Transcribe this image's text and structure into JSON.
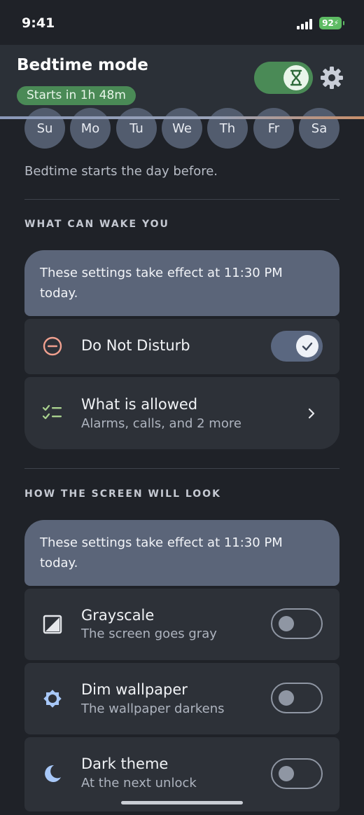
{
  "status": {
    "time": "9:41",
    "battery": "92"
  },
  "header": {
    "title": "Bedtime mode",
    "badge": "Starts in 1h 48m"
  },
  "days": [
    "Su",
    "Mo",
    "Tu",
    "We",
    "Th",
    "Fr",
    "Sa"
  ],
  "days_note": "Bedtime starts the day before.",
  "wake": {
    "section_title": "WHAT CAN WAKE YOU",
    "banner": "These settings take effect at 11:30 PM today.",
    "dnd_label": "Do Not Disturb",
    "allowed_title": "What is allowed",
    "allowed_sub": "Alarms, calls, and 2 more"
  },
  "screen": {
    "section_title": "HOW THE SCREEN WILL LOOK",
    "banner": "These settings take effect at 11:30 PM today.",
    "grayscale_title": "Grayscale",
    "grayscale_sub": "The screen goes gray",
    "dim_title": "Dim wallpaper",
    "dim_sub": "The wallpaper darkens",
    "dark_title": "Dark theme",
    "dark_sub": "At the next unlock"
  },
  "colors": {
    "accent_green": "#4a8a56",
    "banner": "#5b6579",
    "dnd_icon": "#f0a08f",
    "allowed_icon": "#a9d18e",
    "moon": "#a8c8f8"
  }
}
